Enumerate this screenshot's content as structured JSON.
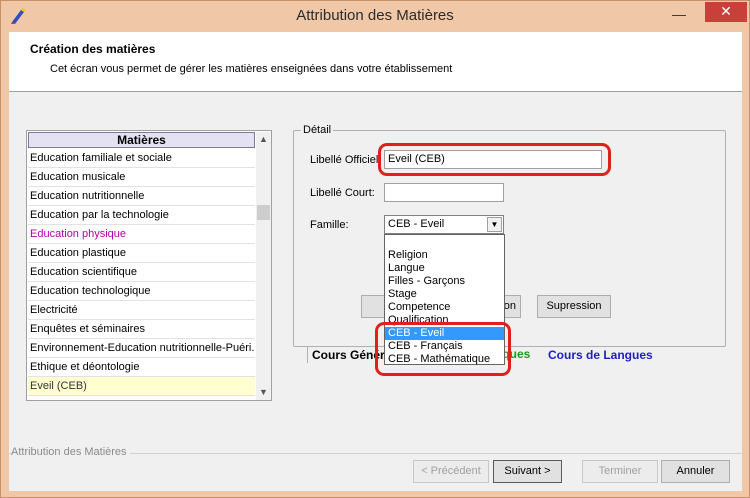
{
  "window": {
    "title": "Attribution des Matières",
    "minimize_label": "—",
    "close_label": "✕",
    "app_icon": "pen-icon"
  },
  "header": {
    "title": "Création des matières",
    "subtitle": "Cet écran vous permet de gérer les matières enseignées dans votre établissement"
  },
  "subjects_list": {
    "header": "Matières",
    "items": [
      "Education familiale et sociale",
      "Education musicale",
      "Education nutritionnelle",
      "Education par la technologie",
      "Education physique",
      "Education plastique",
      "Education scientifique",
      "Education technologique",
      "Electricité",
      "Enquêtes et séminaires",
      "Environnement-Education nutritionnelle-Puéri...",
      "Ethique et déontologie",
      "Eveil (CEB)"
    ],
    "selected": "Eveil (CEB)",
    "highlighted_color_item": "Education physique"
  },
  "detail": {
    "legend": "Détail",
    "libelle_officiel_label": "Libellé Officiel:",
    "libelle_officiel_value": "Eveil (CEB)",
    "libelle_court_label": "Libellé Court:",
    "libelle_court_value": "",
    "famille_label": "Famille:",
    "famille_value": "CEB - Eveil",
    "button_partial_right": "on",
    "supression_label": "Supression"
  },
  "famille_dropdown": {
    "options": [
      "Religion",
      "Langue",
      "Filles - Garçons",
      "Stage",
      "Competence",
      "Qualification",
      "CEB - Eveil",
      "CEB - Français",
      "CEB - Mathématique"
    ],
    "selected": "CEB - Eveil"
  },
  "tabs": {
    "cours_generaux": "Cours Génér",
    "partial_middle": "iques",
    "cours_de_langues": "Cours de Langues"
  },
  "footer": {
    "caption": "Attribution des Matières",
    "precedent": "< Précédent",
    "suivant": "Suivant >",
    "terminer": "Terminer",
    "annuler": "Annuler"
  },
  "colors": {
    "frame": "#f0c8a8",
    "close_button": "#c7403a",
    "selection": "#3399ff",
    "annotation": "#e0201c",
    "list_header": "#e4e2f2",
    "selected_row": "#ffffd0",
    "magenta_text": "#b000b0",
    "tab_green": "#1a9a1a",
    "tab_blue": "#2020c0"
  }
}
